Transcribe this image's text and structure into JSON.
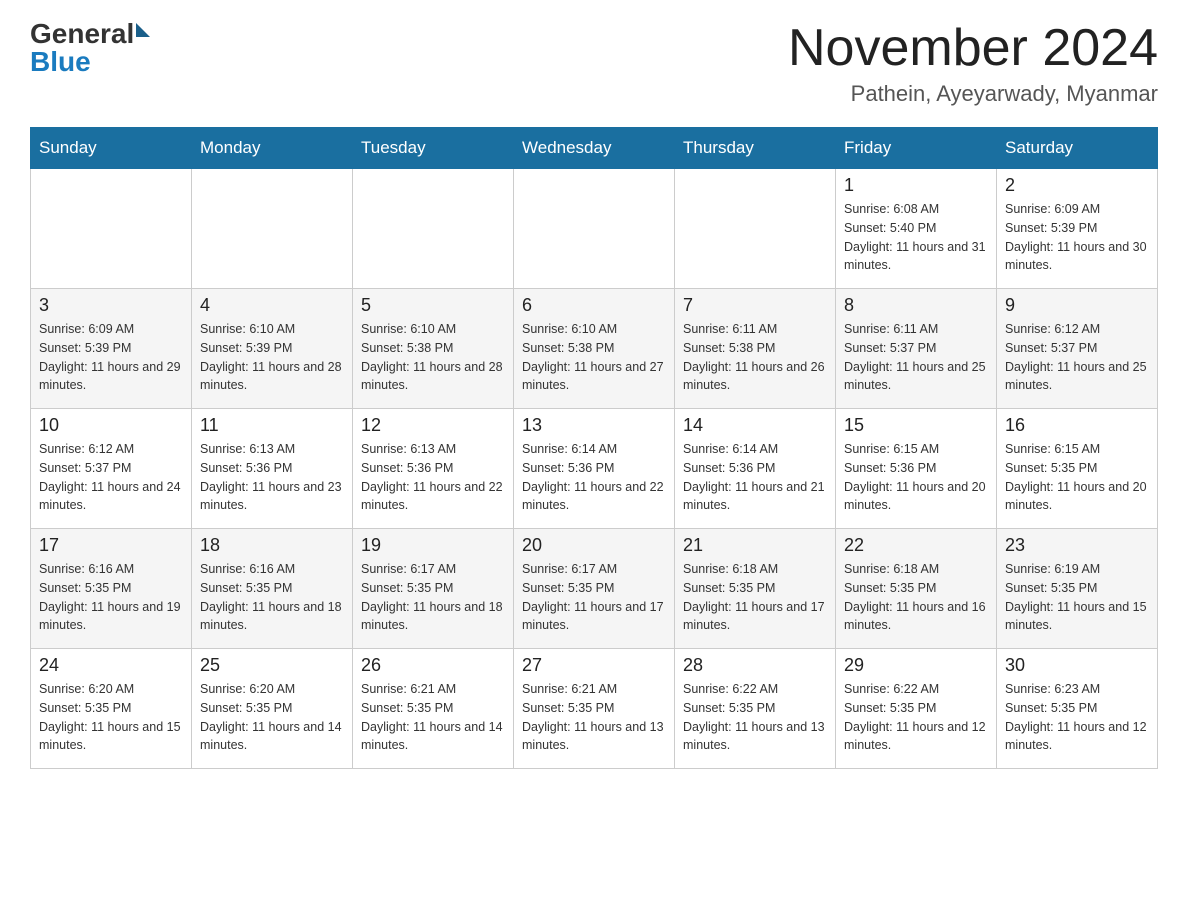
{
  "header": {
    "title": "November 2024",
    "subtitle": "Pathein, Ayeyarwady, Myanmar",
    "logo_general": "General",
    "logo_blue": "Blue"
  },
  "days_of_week": [
    "Sunday",
    "Monday",
    "Tuesday",
    "Wednesday",
    "Thursday",
    "Friday",
    "Saturday"
  ],
  "weeks": [
    [
      {
        "day": "",
        "sunrise": "",
        "sunset": "",
        "daylight": ""
      },
      {
        "day": "",
        "sunrise": "",
        "sunset": "",
        "daylight": ""
      },
      {
        "day": "",
        "sunrise": "",
        "sunset": "",
        "daylight": ""
      },
      {
        "day": "",
        "sunrise": "",
        "sunset": "",
        "daylight": ""
      },
      {
        "day": "",
        "sunrise": "",
        "sunset": "",
        "daylight": ""
      },
      {
        "day": "1",
        "sunrise": "Sunrise: 6:08 AM",
        "sunset": "Sunset: 5:40 PM",
        "daylight": "Daylight: 11 hours and 31 minutes."
      },
      {
        "day": "2",
        "sunrise": "Sunrise: 6:09 AM",
        "sunset": "Sunset: 5:39 PM",
        "daylight": "Daylight: 11 hours and 30 minutes."
      }
    ],
    [
      {
        "day": "3",
        "sunrise": "Sunrise: 6:09 AM",
        "sunset": "Sunset: 5:39 PM",
        "daylight": "Daylight: 11 hours and 29 minutes."
      },
      {
        "day": "4",
        "sunrise": "Sunrise: 6:10 AM",
        "sunset": "Sunset: 5:39 PM",
        "daylight": "Daylight: 11 hours and 28 minutes."
      },
      {
        "day": "5",
        "sunrise": "Sunrise: 6:10 AM",
        "sunset": "Sunset: 5:38 PM",
        "daylight": "Daylight: 11 hours and 28 minutes."
      },
      {
        "day": "6",
        "sunrise": "Sunrise: 6:10 AM",
        "sunset": "Sunset: 5:38 PM",
        "daylight": "Daylight: 11 hours and 27 minutes."
      },
      {
        "day": "7",
        "sunrise": "Sunrise: 6:11 AM",
        "sunset": "Sunset: 5:38 PM",
        "daylight": "Daylight: 11 hours and 26 minutes."
      },
      {
        "day": "8",
        "sunrise": "Sunrise: 6:11 AM",
        "sunset": "Sunset: 5:37 PM",
        "daylight": "Daylight: 11 hours and 25 minutes."
      },
      {
        "day": "9",
        "sunrise": "Sunrise: 6:12 AM",
        "sunset": "Sunset: 5:37 PM",
        "daylight": "Daylight: 11 hours and 25 minutes."
      }
    ],
    [
      {
        "day": "10",
        "sunrise": "Sunrise: 6:12 AM",
        "sunset": "Sunset: 5:37 PM",
        "daylight": "Daylight: 11 hours and 24 minutes."
      },
      {
        "day": "11",
        "sunrise": "Sunrise: 6:13 AM",
        "sunset": "Sunset: 5:36 PM",
        "daylight": "Daylight: 11 hours and 23 minutes."
      },
      {
        "day": "12",
        "sunrise": "Sunrise: 6:13 AM",
        "sunset": "Sunset: 5:36 PM",
        "daylight": "Daylight: 11 hours and 22 minutes."
      },
      {
        "day": "13",
        "sunrise": "Sunrise: 6:14 AM",
        "sunset": "Sunset: 5:36 PM",
        "daylight": "Daylight: 11 hours and 22 minutes."
      },
      {
        "day": "14",
        "sunrise": "Sunrise: 6:14 AM",
        "sunset": "Sunset: 5:36 PM",
        "daylight": "Daylight: 11 hours and 21 minutes."
      },
      {
        "day": "15",
        "sunrise": "Sunrise: 6:15 AM",
        "sunset": "Sunset: 5:36 PM",
        "daylight": "Daylight: 11 hours and 20 minutes."
      },
      {
        "day": "16",
        "sunrise": "Sunrise: 6:15 AM",
        "sunset": "Sunset: 5:35 PM",
        "daylight": "Daylight: 11 hours and 20 minutes."
      }
    ],
    [
      {
        "day": "17",
        "sunrise": "Sunrise: 6:16 AM",
        "sunset": "Sunset: 5:35 PM",
        "daylight": "Daylight: 11 hours and 19 minutes."
      },
      {
        "day": "18",
        "sunrise": "Sunrise: 6:16 AM",
        "sunset": "Sunset: 5:35 PM",
        "daylight": "Daylight: 11 hours and 18 minutes."
      },
      {
        "day": "19",
        "sunrise": "Sunrise: 6:17 AM",
        "sunset": "Sunset: 5:35 PM",
        "daylight": "Daylight: 11 hours and 18 minutes."
      },
      {
        "day": "20",
        "sunrise": "Sunrise: 6:17 AM",
        "sunset": "Sunset: 5:35 PM",
        "daylight": "Daylight: 11 hours and 17 minutes."
      },
      {
        "day": "21",
        "sunrise": "Sunrise: 6:18 AM",
        "sunset": "Sunset: 5:35 PM",
        "daylight": "Daylight: 11 hours and 17 minutes."
      },
      {
        "day": "22",
        "sunrise": "Sunrise: 6:18 AM",
        "sunset": "Sunset: 5:35 PM",
        "daylight": "Daylight: 11 hours and 16 minutes."
      },
      {
        "day": "23",
        "sunrise": "Sunrise: 6:19 AM",
        "sunset": "Sunset: 5:35 PM",
        "daylight": "Daylight: 11 hours and 15 minutes."
      }
    ],
    [
      {
        "day": "24",
        "sunrise": "Sunrise: 6:20 AM",
        "sunset": "Sunset: 5:35 PM",
        "daylight": "Daylight: 11 hours and 15 minutes."
      },
      {
        "day": "25",
        "sunrise": "Sunrise: 6:20 AM",
        "sunset": "Sunset: 5:35 PM",
        "daylight": "Daylight: 11 hours and 14 minutes."
      },
      {
        "day": "26",
        "sunrise": "Sunrise: 6:21 AM",
        "sunset": "Sunset: 5:35 PM",
        "daylight": "Daylight: 11 hours and 14 minutes."
      },
      {
        "day": "27",
        "sunrise": "Sunrise: 6:21 AM",
        "sunset": "Sunset: 5:35 PM",
        "daylight": "Daylight: 11 hours and 13 minutes."
      },
      {
        "day": "28",
        "sunrise": "Sunrise: 6:22 AM",
        "sunset": "Sunset: 5:35 PM",
        "daylight": "Daylight: 11 hours and 13 minutes."
      },
      {
        "day": "29",
        "sunrise": "Sunrise: 6:22 AM",
        "sunset": "Sunset: 5:35 PM",
        "daylight": "Daylight: 11 hours and 12 minutes."
      },
      {
        "day": "30",
        "sunrise": "Sunrise: 6:23 AM",
        "sunset": "Sunset: 5:35 PM",
        "daylight": "Daylight: 11 hours and 12 minutes."
      }
    ]
  ]
}
